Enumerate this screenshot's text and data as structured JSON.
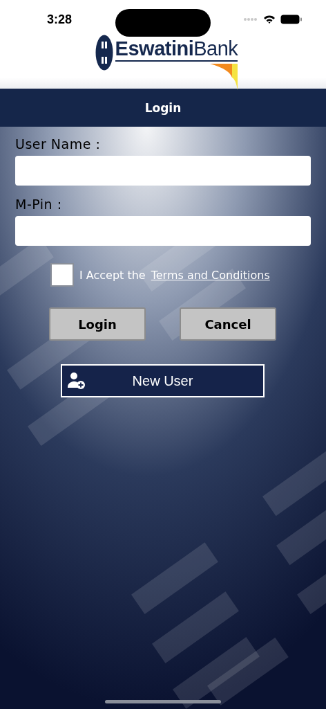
{
  "status_bar": {
    "time": "3:28"
  },
  "logo": {
    "text": "**Eswatini**Bank"
  },
  "header": {
    "title": "Login"
  },
  "form": {
    "fields": [
      {
        "label": "User Name :"
      },
      {
        "label": "M-Pin :"
      }
    ],
    "terms": {
      "checked": false,
      "text": "I Accept the",
      "link": "Terms and Conditions"
    },
    "buttons": [
      {
        "label": "Login"
      },
      {
        "label": "Cancel"
      }
    ],
    "new_user": {
      "label": "New User"
    }
  }
}
